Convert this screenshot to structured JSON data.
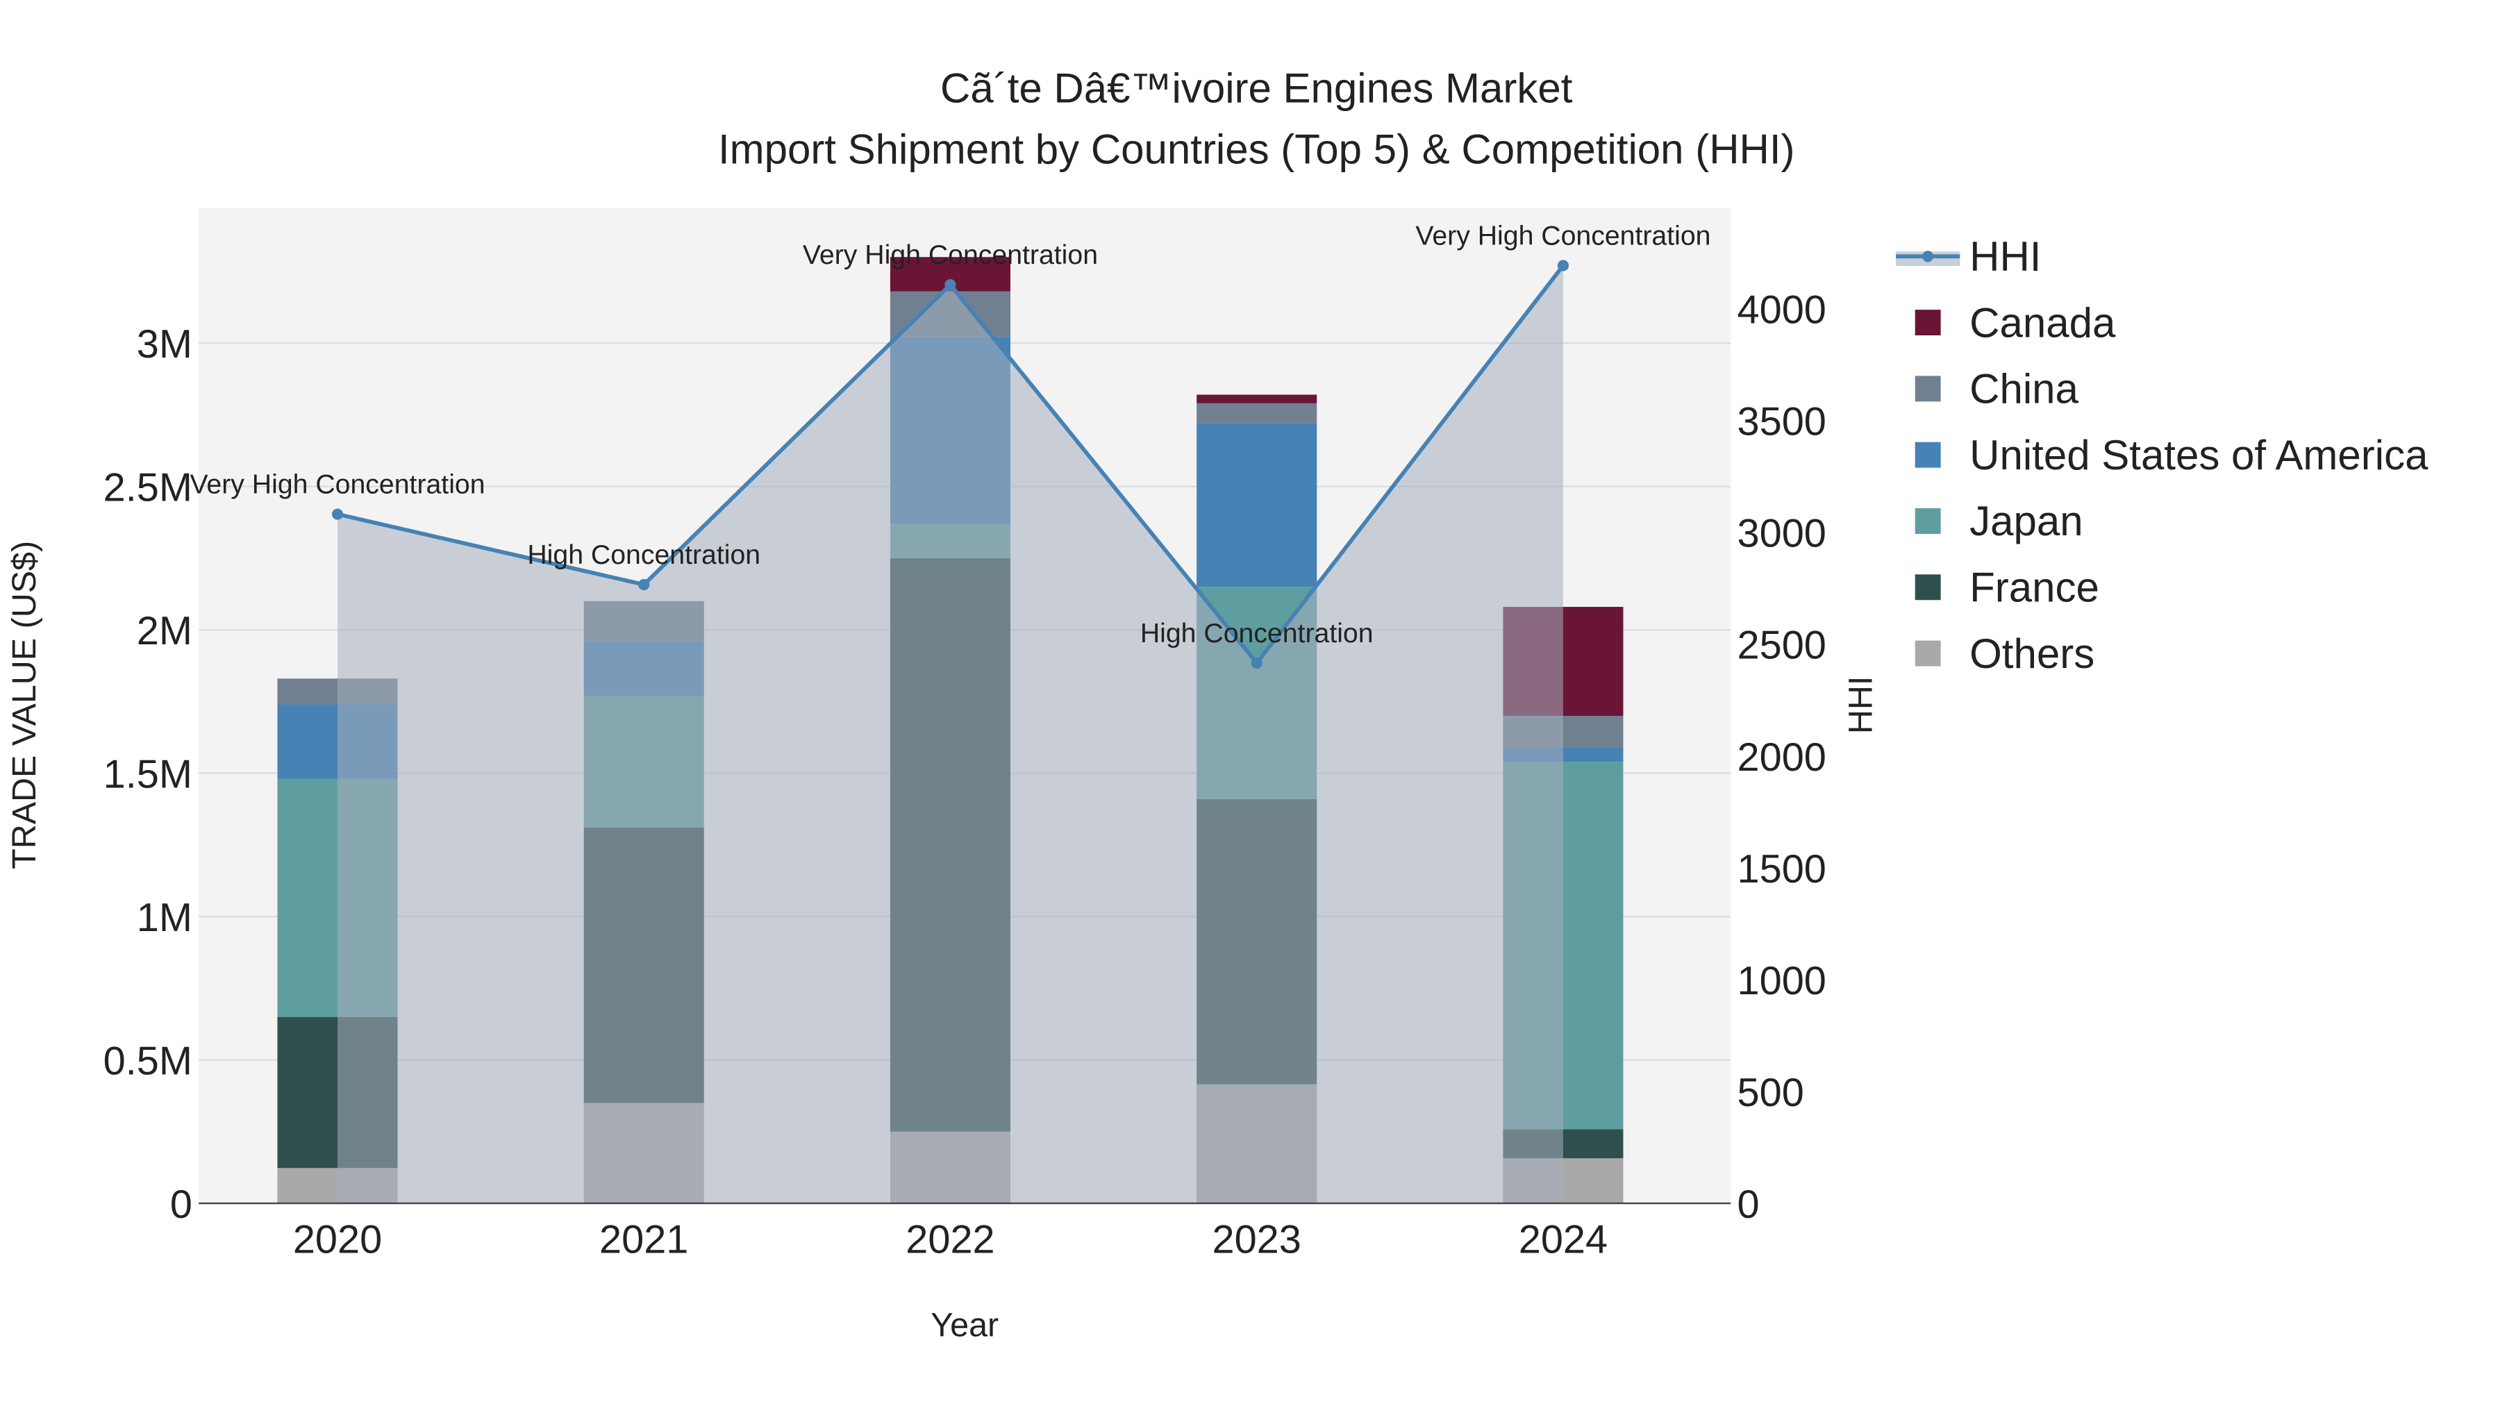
{
  "chart_data": {
    "type": "bar",
    "title": "Cã´te Dâ€™ivoire  Engines Market",
    "subtitle": "Import Shipment by Countries (Top 5) & Competition (HHI)",
    "xlabel": "Year",
    "ylabel": "TRADE VALUE (US$)",
    "y2label": "HHI",
    "categories": [
      "2020",
      "2021",
      "2022",
      "2023",
      "2024"
    ],
    "ylim": [
      0,
      3470000
    ],
    "y2lim": [
      0,
      4450
    ],
    "yticks": [
      {
        "v": 0,
        "label": "0"
      },
      {
        "v": 500000,
        "label": "0.5M"
      },
      {
        "v": 1000000,
        "label": "1M"
      },
      {
        "v": 1500000,
        "label": "1.5M"
      },
      {
        "v": 2000000,
        "label": "2M"
      },
      {
        "v": 2500000,
        "label": "2.5M"
      },
      {
        "v": 3000000,
        "label": "3M"
      }
    ],
    "y2ticks": [
      {
        "v": 0,
        "label": "0"
      },
      {
        "v": 500,
        "label": "500"
      },
      {
        "v": 1000,
        "label": "1000"
      },
      {
        "v": 1500,
        "label": "1500"
      },
      {
        "v": 2000,
        "label": "2000"
      },
      {
        "v": 2500,
        "label": "2500"
      },
      {
        "v": 3000,
        "label": "3000"
      },
      {
        "v": 3500,
        "label": "3500"
      },
      {
        "v": 4000,
        "label": "4000"
      }
    ],
    "series": [
      {
        "name": "Others",
        "color": "#a9a9a9",
        "values": [
          123000,
          350000,
          250000,
          415000,
          157000
        ]
      },
      {
        "name": "France",
        "color": "#2f4f4f",
        "values": [
          527000,
          960000,
          2000000,
          995000,
          101000
        ]
      },
      {
        "name": "Japan",
        "color": "#5f9ea0",
        "values": [
          830000,
          460000,
          120000,
          740000,
          1282000
        ]
      },
      {
        "name": "United States of America",
        "color": "#4682b4",
        "values": [
          260000,
          190000,
          650000,
          570000,
          50000
        ]
      },
      {
        "name": "China",
        "color": "#708090",
        "values": [
          90000,
          140000,
          160000,
          70000,
          110000
        ]
      },
      {
        "name": "Canada",
        "color": "#6b1536",
        "values": [
          0,
          0,
          120000,
          30000,
          380000
        ]
      }
    ],
    "hhi": {
      "name": "HHI",
      "color": "#4682b4",
      "values": [
        3082,
        2767,
        4108,
        2416,
        4194
      ],
      "annotations": [
        "Very High Concentration",
        "High Concentration",
        "Very High Concentration",
        "High Concentration",
        "Very High Concentration"
      ]
    },
    "legend": [
      "HHI",
      "Canada",
      "China",
      "United States of America",
      "Japan",
      "France",
      "Others"
    ],
    "legend_position": "right",
    "grid": true
  }
}
